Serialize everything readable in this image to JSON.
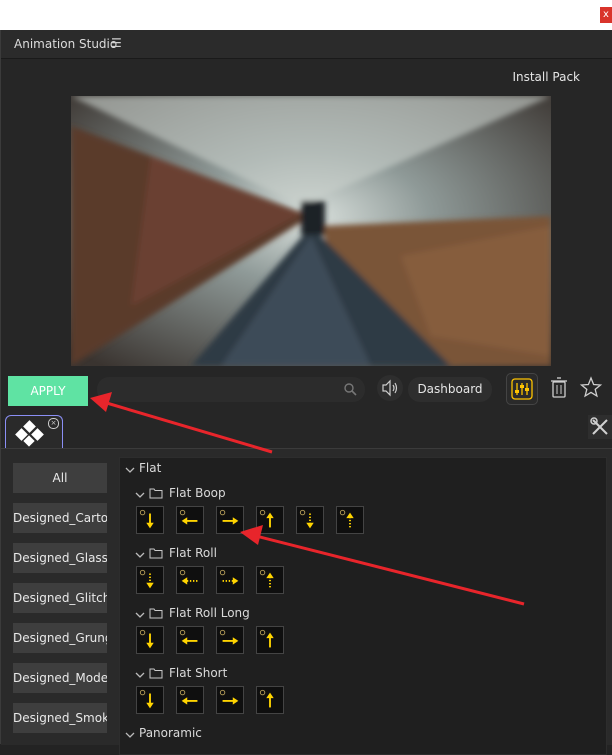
{
  "window": {
    "close_glyph": "x"
  },
  "panel": {
    "title": "Animation Studio",
    "menu_glyph": "☰",
    "install_label": "Install Pack"
  },
  "controls": {
    "apply_label": "APPLY",
    "search_placeholder": "",
    "dashboard_label": "Dashboard"
  },
  "categories": [
    "All",
    "Designed_Cartoon",
    "Designed_Glass",
    "Designed_Glitch",
    "Designed_Grunge",
    "Designed_Modern",
    "Designed_Smoke"
  ],
  "tree": {
    "root": "Flat",
    "groups": [
      {
        "name": "Flat Boop",
        "effects": [
          "down",
          "left",
          "right",
          "up",
          "down-dotted",
          "up-dotted"
        ]
      },
      {
        "name": "Flat Roll",
        "effects": [
          "down-dotted",
          "left-dotted",
          "right-dotted",
          "up-dotted"
        ]
      },
      {
        "name": "Flat Roll Long",
        "effects": [
          "down",
          "left",
          "right",
          "up"
        ]
      },
      {
        "name": "Flat Short",
        "effects": [
          "down",
          "left",
          "right",
          "up"
        ]
      }
    ],
    "next_root": "Panoramic"
  },
  "colors": {
    "apply_green": "#5fe3a3",
    "tab_border": "#8b8ff5",
    "arrow_yellow": "#ffd400",
    "annotation_red": "#e8252b"
  },
  "icons": {
    "speaker": "speaker-icon",
    "mixer": "mixer-icon",
    "trash": "trash-icon",
    "star": "star-icon",
    "tools": "tools-icon",
    "search": "search-icon"
  }
}
